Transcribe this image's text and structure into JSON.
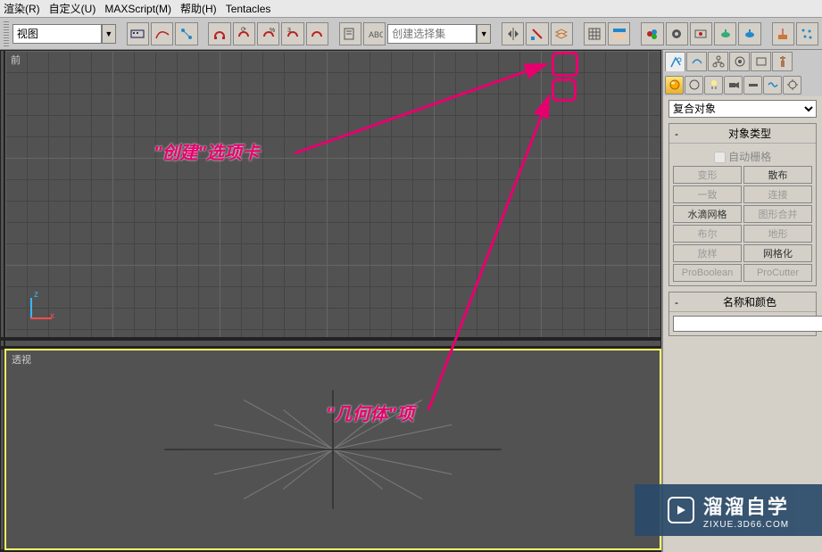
{
  "menu": {
    "render": "渲染(R)",
    "custom": "自定义(U)",
    "maxscript": "MAXScript(M)",
    "help": "帮助(H)",
    "tentacles": "Tentacles"
  },
  "toolbar": {
    "viewport_label": "视图",
    "selection_set_placeholder": "创建选择集"
  },
  "viewports": {
    "front": "前",
    "perspective": "透视"
  },
  "panel": {
    "dropdown": "复合对象",
    "rollout_type": "对象类型",
    "autogrid": "自动栅格",
    "buttons": [
      "变形",
      "散布",
      "一致",
      "连接",
      "水滴网格",
      "图形合并",
      "布尔",
      "地形",
      "放样",
      "网格化",
      "ProBoolean",
      "ProCutter"
    ],
    "rollout_name": "名称和颜色"
  },
  "annotations": {
    "create_tab": "\"创建\"选项卡",
    "geometry_item": "\"几何体\"项"
  },
  "watermark": {
    "text": "溜溜自学",
    "url": "ZIXUE.3D66.COM"
  }
}
